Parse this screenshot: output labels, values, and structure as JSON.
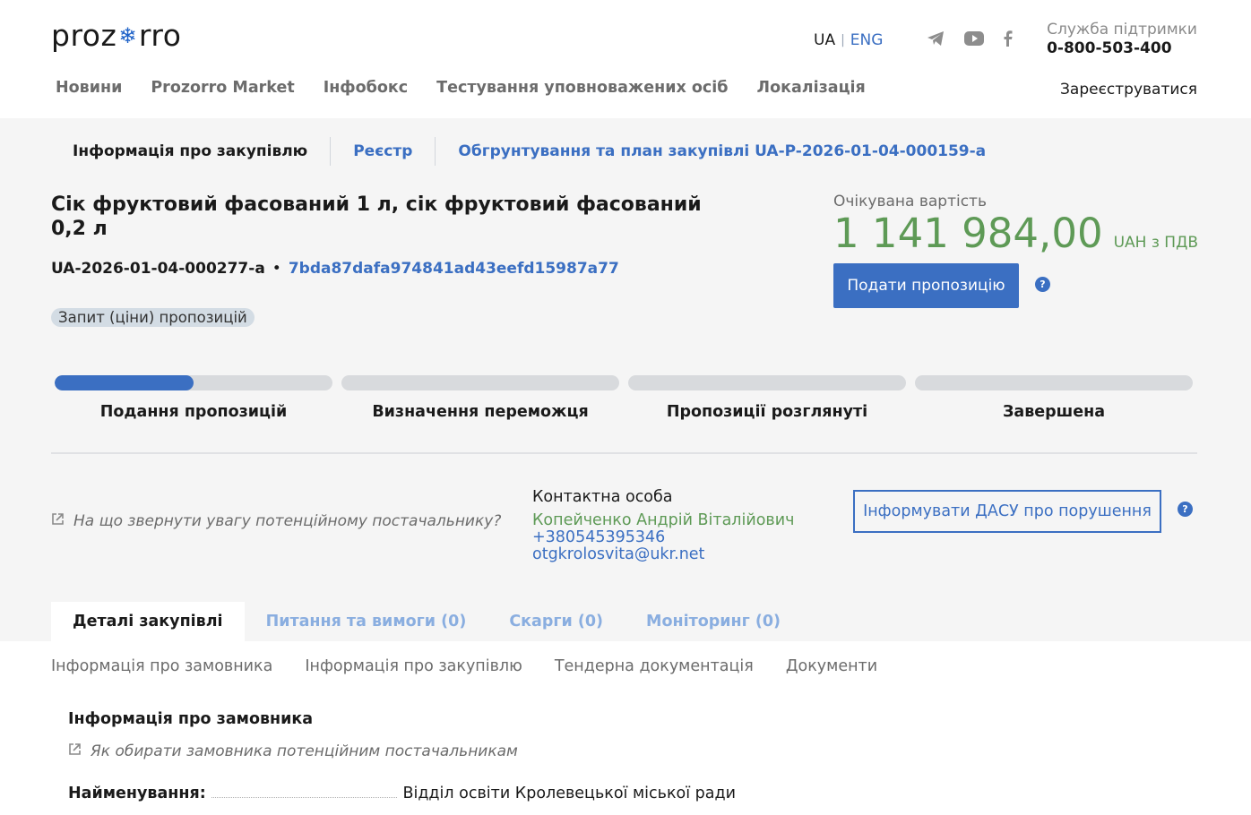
{
  "header": {
    "logo_left": "proz",
    "logo_right": "rro",
    "lang_ua": "UA",
    "lang_eng": "ENG",
    "support_label": "Служба підтримки",
    "support_phone": "0-800-503-400",
    "register": "Зареєструватися",
    "nav": [
      "Новини",
      "Prozorro Market",
      "Інфобокс",
      "Тестування уповноважених осіб",
      "Локалізація"
    ]
  },
  "breadcrumbs": [
    "Інформація про закупівлю",
    "Реєстр",
    "Обгрунтування та план закупівлі UA-P-2026-01-04-000159-a"
  ],
  "tender": {
    "title": "Сік фруктовий фасований 1 л, сік фруктовий фасований 0,2 л",
    "tender_id": "UA-2026-01-04-000277-a",
    "separator": "•",
    "hash": "7bda87dafa974841ad43eefd15987a77",
    "status": "Запит (ціни) пропозицій",
    "expected_label": "Очікувана вартість",
    "amount": "1 141 984,00",
    "currency": "UAH з ПДВ",
    "submit_label": "Подати пропозицію",
    "help_symbol": "?"
  },
  "stages": [
    {
      "label": "Подання пропозицій",
      "progress": 0.5
    },
    {
      "label": "Визначення переможця",
      "progress": 0
    },
    {
      "label": "Пропозиції розглянуті",
      "progress": 0
    },
    {
      "label": "Завершена",
      "progress": 0
    }
  ],
  "contact": {
    "hint": "На що звернути увагу потенційному постачальнику?",
    "label": "Контактна особа",
    "name": "Копейченко Андрій Віталійович",
    "phone": "+380545395346",
    "email": "otgkrolosvita@ukr.net",
    "dasu_label": "Інформувати ДАСУ про порушення"
  },
  "tabs": [
    "Деталі закупівлі",
    "Питання та вимоги (0)",
    "Скарги (0)",
    "Моніторинг (0)"
  ],
  "subnav": [
    "Інформація про замовника",
    "Інформація про закупівлю",
    "Тендерна документація",
    "Документи"
  ],
  "customer": {
    "title": "Інформація про замовника",
    "hint": "Як обирати замовника потенційним постачальникам",
    "name_key": "Найменування:",
    "name_val": "Відділ освіти Кролевецької міської ради"
  },
  "colors": {
    "accent": "#3b6fc2",
    "green": "#5e9a56"
  },
  "icons": [
    "telegram-icon",
    "youtube-icon",
    "facebook-icon",
    "external-link-icon",
    "help-icon",
    "snowflake-icon"
  ]
}
